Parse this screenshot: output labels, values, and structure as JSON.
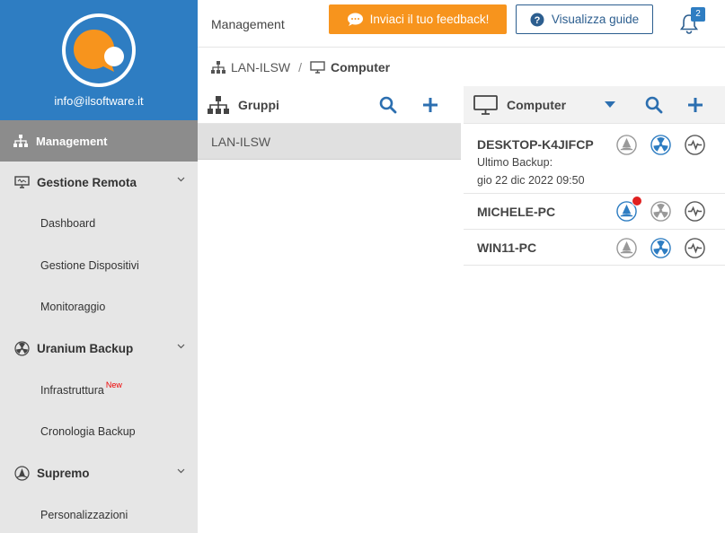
{
  "sidebar": {
    "email": "info@ilsoftware.it",
    "active": "Management",
    "groups": [
      {
        "label": "Gestione Remota",
        "icon": "monitor-icon",
        "items": [
          "Dashboard",
          "Gestione Dispositivi",
          "Monitoraggio"
        ]
      },
      {
        "label": "Uranium Backup",
        "icon": "radiation-icon",
        "items": [
          "Infrastruttura",
          "Cronologia Backup"
        ],
        "new_badge": "New"
      },
      {
        "label": "Supremo",
        "icon": "supremo-icon",
        "items": [
          "Personalizzazioni"
        ]
      }
    ]
  },
  "header": {
    "title": "Management",
    "feedback_label": "Inviaci il tuo feedback!",
    "guide_label": "Visualizza guide",
    "notifications": "2"
  },
  "breadcrumb": {
    "root": "LAN-ILSW",
    "current": "Computer"
  },
  "groups_panel": {
    "title": "Gruppi",
    "rows": [
      "LAN-ILSW"
    ]
  },
  "computers_panel": {
    "title": "Computer",
    "rows": [
      {
        "name": "DESKTOP-K4JIFCP",
        "sub1": "Ultimo Backup:",
        "sub2": "gio 22 dic 2022 09:50"
      },
      {
        "name": "MICHELE-PC"
      },
      {
        "name": "WIN11-PC"
      }
    ]
  },
  "colors": {
    "brand": "#2e7dc2",
    "feedback": "#f7941d",
    "sidebar_active": "#8c8c8c",
    "alert": "#e02020"
  }
}
